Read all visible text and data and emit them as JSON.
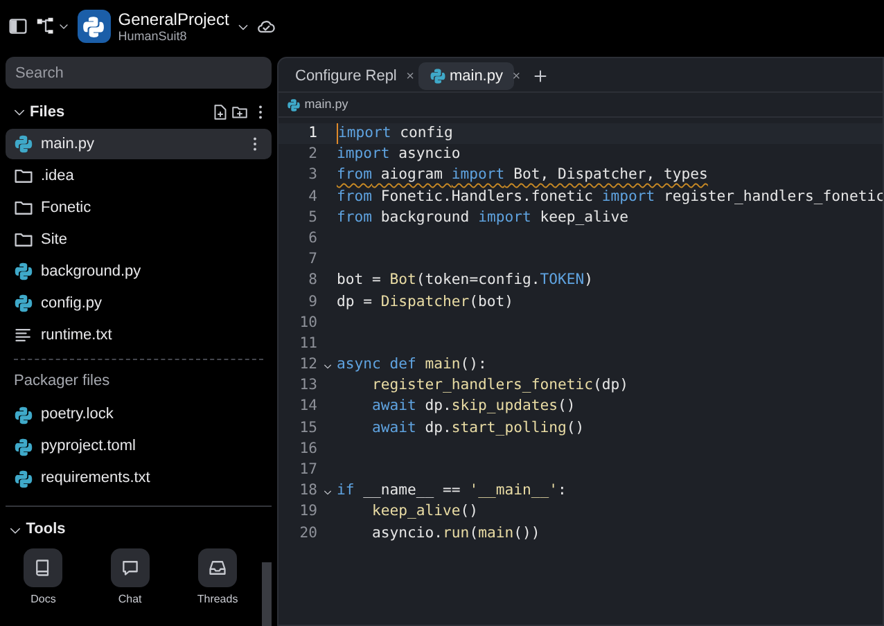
{
  "project": {
    "name": "GeneralProject",
    "owner": "HumanSuit8"
  },
  "search": {
    "placeholder": "Search"
  },
  "files": {
    "title": "Files",
    "expanded": true,
    "items": [
      {
        "name": "main.py",
        "kind": "python",
        "selected": true
      },
      {
        "name": ".idea",
        "kind": "folder",
        "selected": false
      },
      {
        "name": "Fonetic",
        "kind": "folder",
        "selected": false
      },
      {
        "name": "Site",
        "kind": "folder",
        "selected": false
      },
      {
        "name": "background.py",
        "kind": "python",
        "selected": false
      },
      {
        "name": "config.py",
        "kind": "python",
        "selected": false
      },
      {
        "name": "runtime.txt",
        "kind": "text",
        "selected": false
      }
    ]
  },
  "packager": {
    "title": "Packager files",
    "items": [
      {
        "name": "poetry.lock",
        "kind": "python",
        "selected": false
      },
      {
        "name": "pyproject.toml",
        "kind": "python",
        "selected": false
      },
      {
        "name": "requirements.txt",
        "kind": "python",
        "selected": false
      }
    ]
  },
  "tools": {
    "title": "Tools",
    "expanded": true,
    "items": [
      {
        "label": "Docs",
        "kind": "book"
      },
      {
        "label": "Chat",
        "kind": "chat"
      },
      {
        "label": "Threads",
        "kind": "inbox"
      }
    ]
  },
  "tabs": [
    {
      "label": "Configure Repl",
      "kind": "tool",
      "close": "×",
      "selected": false
    },
    {
      "label": "main.py",
      "kind": "python",
      "close": "×",
      "selected": true
    }
  ],
  "breadcrumb": "main.py",
  "lines": [
    {
      "number": "1",
      "current": true,
      "warning": false,
      "foldable": false,
      "tokens": [
        {
          "kind": "kw",
          "text": "import"
        },
        {
          "kind": "pl",
          "text": " config"
        }
      ]
    },
    {
      "number": "2",
      "current": false,
      "warning": false,
      "foldable": false,
      "tokens": [
        {
          "kind": "kw",
          "text": "import"
        },
        {
          "kind": "pl",
          "text": " asyncio"
        }
      ]
    },
    {
      "number": "3",
      "current": false,
      "warning": true,
      "foldable": false,
      "tokens": [
        {
          "kind": "kw",
          "text": "from"
        },
        {
          "kind": "pl",
          "text": " aiogram "
        },
        {
          "kind": "kw",
          "text": "import"
        },
        {
          "kind": "pl",
          "text": " Bot, Dispatcher, types"
        }
      ]
    },
    {
      "number": "4",
      "current": false,
      "warning": false,
      "foldable": false,
      "tokens": [
        {
          "kind": "kw",
          "text": "from"
        },
        {
          "kind": "pl",
          "text": " Fonetic.Handlers.fonetic "
        },
        {
          "kind": "kw",
          "text": "import"
        },
        {
          "kind": "pl",
          "text": " register_handlers_fonetic"
        }
      ]
    },
    {
      "number": "5",
      "current": false,
      "warning": false,
      "foldable": false,
      "tokens": [
        {
          "kind": "kw",
          "text": "from"
        },
        {
          "kind": "pl",
          "text": " background "
        },
        {
          "kind": "kw",
          "text": "import"
        },
        {
          "kind": "pl",
          "text": " keep_alive"
        }
      ]
    },
    {
      "number": "6",
      "current": false,
      "foldable": false
    },
    {
      "number": "7",
      "current": false,
      "foldable": false
    },
    {
      "number": "8",
      "current": false,
      "warning": false,
      "foldable": false,
      "tokens": [
        {
          "kind": "pl",
          "text": "bot = "
        },
        {
          "kind": "fn",
          "text": "Bot"
        },
        {
          "kind": "pl",
          "text": "(token=config."
        },
        {
          "kind": "kw",
          "text": "TOKEN"
        },
        {
          "kind": "pl",
          "text": ")"
        }
      ]
    },
    {
      "number": "9",
      "current": false,
      "warning": false,
      "foldable": false,
      "tokens": [
        {
          "kind": "pl",
          "text": "dp = "
        },
        {
          "kind": "fn",
          "text": "Dispatcher"
        },
        {
          "kind": "pl",
          "text": "(bot)"
        }
      ]
    },
    {
      "number": "10",
      "current": false,
      "foldable": false
    },
    {
      "number": "11",
      "current": false,
      "foldable": false
    },
    {
      "number": "12",
      "current": false,
      "warning": false,
      "foldable": true,
      "tokens": [
        {
          "kind": "kw",
          "text": "async def"
        },
        {
          "kind": "fn",
          "text": " main"
        },
        {
          "kind": "pl",
          "text": "():"
        }
      ]
    },
    {
      "number": "13",
      "current": false,
      "warning": false,
      "foldable": false,
      "tokens": [
        {
          "kind": "fn",
          "text": "    register_handlers_fonetic"
        },
        {
          "kind": "pl",
          "text": "(dp)"
        }
      ]
    },
    {
      "number": "14",
      "current": false,
      "warning": false,
      "foldable": false,
      "tokens": [
        {
          "kind": "kw",
          "text": "    await"
        },
        {
          "kind": "pl",
          "text": " dp."
        },
        {
          "kind": "fn",
          "text": "skip_updates"
        },
        {
          "kind": "pl",
          "text": "()"
        }
      ]
    },
    {
      "number": "15",
      "current": false,
      "warning": false,
      "foldable": false,
      "tokens": [
        {
          "kind": "kw",
          "text": "    await"
        },
        {
          "kind": "pl",
          "text": " dp."
        },
        {
          "kind": "fn",
          "text": "start_polling"
        },
        {
          "kind": "pl",
          "text": "()"
        }
      ]
    },
    {
      "number": "16",
      "current": false,
      "foldable": false
    },
    {
      "number": "17",
      "current": false,
      "foldable": false
    },
    {
      "number": "18",
      "current": false,
      "warning": false,
      "foldable": true,
      "tokens": [
        {
          "kind": "kw",
          "text": "if"
        },
        {
          "kind": "pl",
          "text": " __name__ == "
        },
        {
          "kind": "str",
          "text": "'__main__'"
        },
        {
          "kind": "pl",
          "text": ":"
        }
      ]
    },
    {
      "number": "19",
      "current": false,
      "warning": false,
      "foldable": false,
      "tokens": [
        {
          "kind": "fn",
          "text": "    keep_alive"
        },
        {
          "kind": "pl",
          "text": "()"
        }
      ]
    },
    {
      "number": "20",
      "current": false,
      "warning": false,
      "foldable": false,
      "tokens": [
        {
          "kind": "pl",
          "text": "    asyncio."
        },
        {
          "kind": "fn",
          "text": "run"
        },
        {
          "kind": "pl",
          "text": "("
        },
        {
          "kind": "fn",
          "text": "main"
        },
        {
          "kind": "pl",
          "text": "())"
        }
      ]
    }
  ]
}
